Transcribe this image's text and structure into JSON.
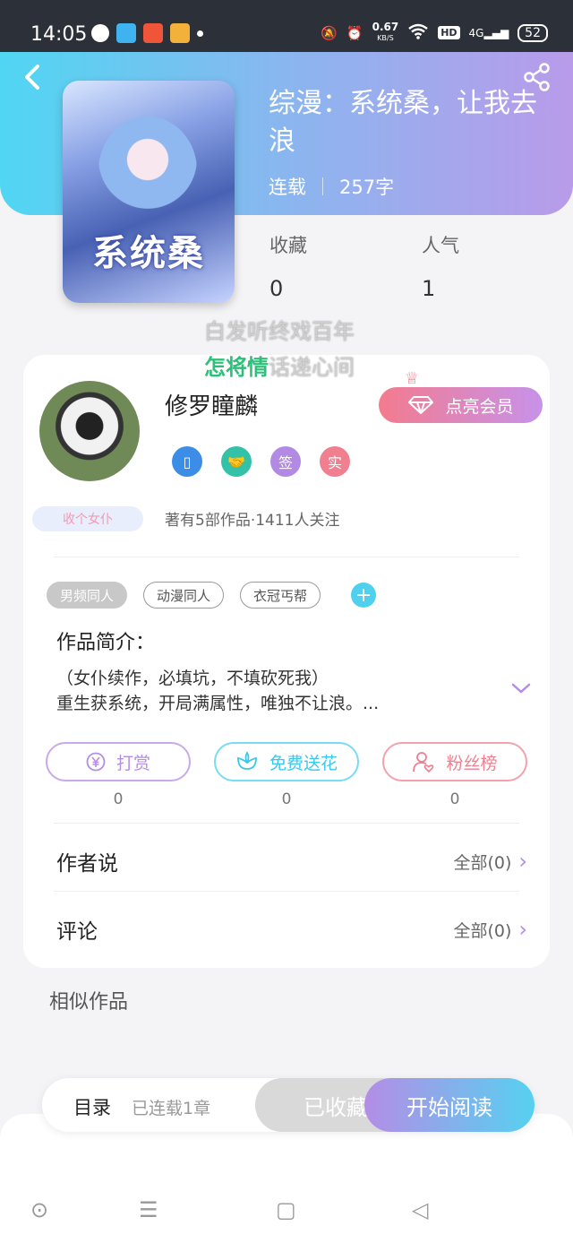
{
  "status_bar": {
    "time": "14:05",
    "speed_value": "0.67",
    "speed_unit": "KB/S",
    "hd": "HD",
    "network": "4G",
    "battery": "52"
  },
  "header": {
    "title": "综漫：系统桑，让我去浪",
    "status": "连载",
    "word_count": "257字",
    "cover_title": "系统桑"
  },
  "stats": [
    {
      "label": "收藏",
      "value": "0"
    },
    {
      "label": "人气",
      "value": "1"
    }
  ],
  "overlay": {
    "line1": "白发听终戏百年",
    "line2_green": "怎将情",
    "line2_rest": "话递心间"
  },
  "author": {
    "name": "修罗瞳麟",
    "vip_label": "点亮会员",
    "badges": [
      {
        "text": "",
        "color": "#3b8de6"
      },
      {
        "text": "",
        "color": "#33c2a8"
      },
      {
        "text": "签",
        "color": "#b28ae3"
      },
      {
        "text": "实",
        "color": "#f07f8f"
      }
    ],
    "fan_club": "收个女仆",
    "stats_text": "著有5部作品·1411人关注"
  },
  "tags": [
    "男频同人",
    "动漫同人",
    "衣冠丐帮"
  ],
  "intro": {
    "label": "作品简介：",
    "line1": "（女仆续作，必填坑，不填砍死我）",
    "line2": "重生获系统，开局满属性，唯独不让浪。..."
  },
  "actions": [
    {
      "label": "打赏",
      "count": "0",
      "color": "#b48de6"
    },
    {
      "label": "免费送花",
      "count": "0",
      "color": "#4fd0ef"
    },
    {
      "label": "粉丝榜",
      "count": "0",
      "color": "#f07f8f"
    }
  ],
  "author_say": {
    "label": "作者说",
    "right": "全部(0)"
  },
  "comments": {
    "label": "评论",
    "right": "全部(0)"
  },
  "similar_label": "相似作品",
  "bottom_bar": {
    "toc": "目录",
    "chapters": "已连载1章",
    "favorited": "已收藏",
    "read": "开始阅读"
  }
}
